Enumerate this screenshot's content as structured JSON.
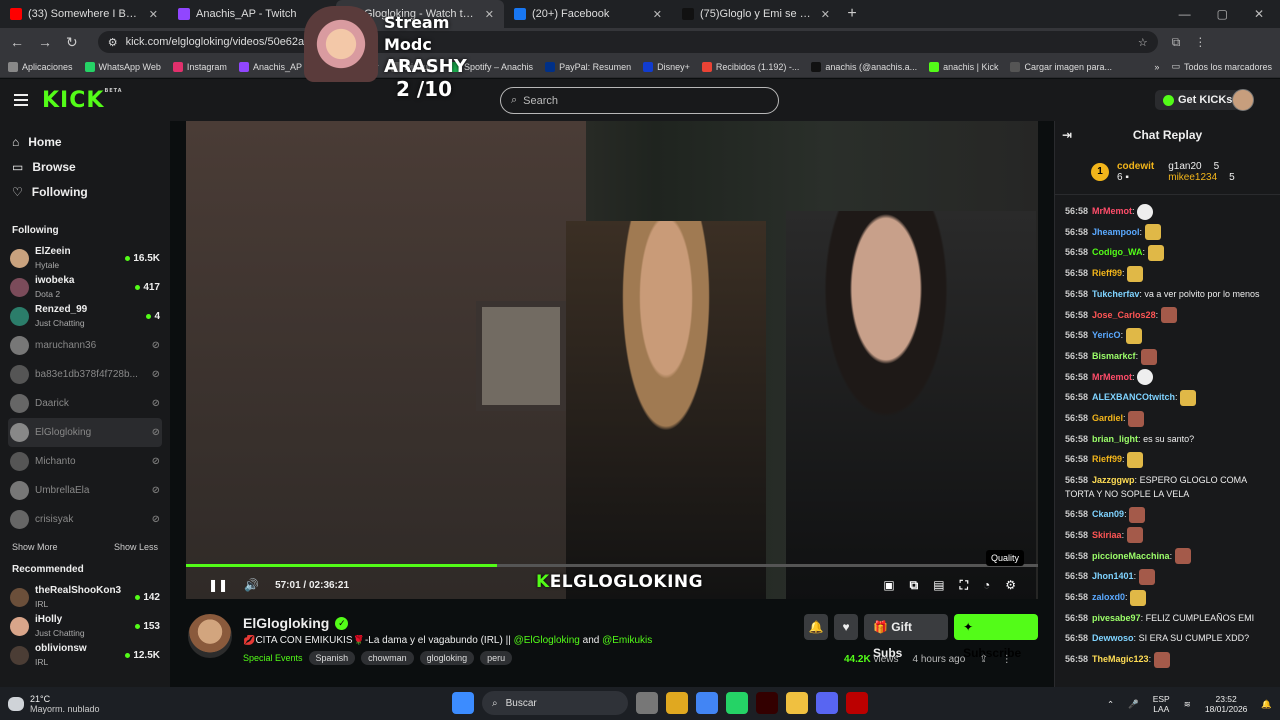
{
  "browser": {
    "tabs": [
      {
        "title": "(33) Somewhere I Belong (C",
        "color": "#ff0000"
      },
      {
        "title": "Anachis_AP - Twitch",
        "color": "#9146ff"
      },
      {
        "title": "Glogloking - Watch the V",
        "color": "#53fc18"
      },
      {
        "title": "(20+) Facebook",
        "color": "#1877f2"
      },
      {
        "title": "(75)Gloglo y Emi se muestran p",
        "color": "#111111"
      }
    ],
    "new_tab": "+",
    "url": "kick.com/elglogloking/videos/50e62a7d-e9e8-41",
    "bookmarks": [
      {
        "label": "Aplicaciones",
        "color": "#888888"
      },
      {
        "label": "WhatsApp Web",
        "color": "#25d366"
      },
      {
        "label": "Instagram",
        "color": "#e1306c"
      },
      {
        "label": "Anachis_AP",
        "color": "#9146ff"
      },
      {
        "label": "ube",
        "color": "#ff0000"
      },
      {
        "label": "Cr",
        "color": "#777777"
      },
      {
        "label": "Disfrut...",
        "color": "#777777"
      },
      {
        "label": "Spotify – Anachis",
        "color": "#1db954"
      },
      {
        "label": "PayPal: Resumen",
        "color": "#003087"
      },
      {
        "label": "Disney+",
        "color": "#113ccf"
      },
      {
        "label": "Recibidos (1.192) -...",
        "color": "#ea4335"
      },
      {
        "label": "anachis (@anachis.a...",
        "color": "#111111"
      },
      {
        "label": "anachis | Kick",
        "color": "#53fc18"
      },
      {
        "label": "Cargar imagen para...",
        "color": "#555555"
      }
    ],
    "bookmarks_more": "»",
    "bookmarks_folder": "Todos los marcadores"
  },
  "overlay": {
    "line1": "Stream Modc",
    "line2": "ARASHY",
    "line3": "2 /10"
  },
  "kick": {
    "logo": "KICK",
    "logo_beta": "BETA",
    "search_placeholder": "Search",
    "get_kicks": "Get KICKs",
    "nav": {
      "home": "Home",
      "browse": "Browse",
      "following": "Following"
    },
    "following_title": "Following",
    "following": [
      {
        "name": "ElZeein",
        "cat": "Hytale",
        "viewers": "16.5K",
        "live": true,
        "color": "#c9a27e"
      },
      {
        "name": "iwobeka",
        "cat": "Dota 2",
        "viewers": "417",
        "live": true,
        "color": "#7b4b5a"
      },
      {
        "name": "Renzed_99",
        "cat": "Just Chatting",
        "viewers": "4",
        "live": true,
        "color": "#2b7d6a"
      },
      {
        "name": "maruchann36",
        "cat": "",
        "viewers": "",
        "live": false,
        "color": "#777777"
      },
      {
        "name": "ba83e1db378f4f728b...",
        "cat": "",
        "viewers": "",
        "live": false,
        "color": "#555555"
      },
      {
        "name": "Daarick",
        "cat": "",
        "viewers": "",
        "live": false,
        "color": "#666666"
      },
      {
        "name": "ElGlogloking",
        "cat": "",
        "viewers": "",
        "live": false,
        "color": "#888888"
      },
      {
        "name": "Michanto",
        "cat": "",
        "viewers": "",
        "live": false,
        "color": "#555555"
      },
      {
        "name": "UmbrellaEla",
        "cat": "",
        "viewers": "",
        "live": false,
        "color": "#777777"
      },
      {
        "name": "crisisyak",
        "cat": "",
        "viewers": "",
        "live": false,
        "color": "#666666"
      }
    ],
    "show_more": "Show More",
    "show_less": "Show Less",
    "recommended_title": "Recommended",
    "recommended": [
      {
        "name": "theRealShooKon3",
        "cat": "IRL",
        "viewers": "142",
        "color": "#6b4f3a"
      },
      {
        "name": "iHolly",
        "cat": "Just Chatting",
        "viewers": "153",
        "color": "#d9a58a"
      },
      {
        "name": "oblivionsw",
        "cat": "IRL",
        "viewers": "12.5K",
        "color": "#4b3d35"
      }
    ],
    "player": {
      "time_current": "57:01",
      "time_total": "02:36:21",
      "time_sep": "/",
      "progress": 0.365,
      "watermark_k": "K",
      "watermark": "ELGLOGLOKING",
      "tooltip": "Quality"
    },
    "channel": {
      "name": "ElGlogloking",
      "title_prefix": "💋CITA CON EMIKUKIS🌹-La dama y el vagabundo (IRL) || ",
      "mention1": "@ElGlogloking",
      "and": " and ",
      "mention2": "@Emikukis",
      "category": "Special Events",
      "tags": [
        "Spanish",
        "chowman",
        "glogloking",
        "peru"
      ],
      "gift_subs": "Gift Subs",
      "subscribe": "Subscribe",
      "views": "44.2K",
      "views_label": "views",
      "ago": "4 hours ago"
    },
    "chat": {
      "title": "Chat Replay",
      "leader1": {
        "rank": "1",
        "name": "codewit",
        "count": "6"
      },
      "leader2": {
        "name": "g1an20",
        "count": "5"
      },
      "leader3": {
        "name": "mikee1234",
        "count": "5"
      },
      "messages": [
        {
          "time": "56:58",
          "user": "MrMemot",
          "color": "#ff4d6a",
          "text": "",
          "emote": "w"
        },
        {
          "time": "56:58",
          "user": "Jheampool",
          "color": "#5aa9ff",
          "text": "",
          "emote": "y"
        },
        {
          "time": "56:58",
          "user": "Codigo_WA",
          "color": "#53fc18",
          "text": "",
          "emote": "y"
        },
        {
          "time": "56:58",
          "user": "Rieff99",
          "color": "#f2b51b",
          "text": "",
          "emote": "y"
        },
        {
          "time": "56:58",
          "user": "Tukcherfav",
          "color": "#7fd3ff",
          "text": "va a ver polvito por lo menos",
          "emote": ""
        },
        {
          "time": "56:58",
          "user": "Jose_Carlos28",
          "color": "#ff5555",
          "text": "",
          "emote": "r"
        },
        {
          "time": "56:58",
          "user": "YericO",
          "color": "#5aa9ff",
          "text": "",
          "emote": "y"
        },
        {
          "time": "56:58",
          "user": "Bismarkcf",
          "color": "#9cff6a",
          "text": "",
          "emote": "r"
        },
        {
          "time": "56:58",
          "user": "MrMemot",
          "color": "#ff4d6a",
          "text": "",
          "emote": "w"
        },
        {
          "time": "56:58",
          "user": "ALEXBANCOtwitch",
          "color": "#7fd3ff",
          "text": "",
          "emote": "y"
        },
        {
          "time": "56:58",
          "user": "Gardiel",
          "color": "#f2b51b",
          "text": "",
          "emote": "r"
        },
        {
          "time": "56:58",
          "user": "brian_light",
          "color": "#9cff6a",
          "text": "es su santo?",
          "emote": ""
        },
        {
          "time": "56:58",
          "user": "Rieff99",
          "color": "#f2b51b",
          "text": "",
          "emote": "y"
        },
        {
          "time": "56:58",
          "user": "Jazzggwp",
          "color": "#ffdd55",
          "text": "ESPERO GLOGLO COMA TORTA Y NO SOPLE LA VELA",
          "emote": ""
        },
        {
          "time": "56:58",
          "user": "Ckan09",
          "color": "#7fd3ff",
          "text": "",
          "emote": "r"
        },
        {
          "time": "56:58",
          "user": "Skiriaa",
          "color": "#ff5555",
          "text": "",
          "emote": "r"
        },
        {
          "time": "56:58",
          "user": "piccioneMacchina",
          "color": "#9cff6a",
          "text": "",
          "emote": "r"
        },
        {
          "time": "56:58",
          "user": "Jhon1401",
          "color": "#7fd3ff",
          "text": "",
          "emote": "r"
        },
        {
          "time": "56:58",
          "user": "zaloxd0",
          "color": "#5aa9ff",
          "text": "",
          "emote": "y"
        },
        {
          "time": "56:58",
          "user": "pivesabe97",
          "color": "#9cff6a",
          "text": "FELIZ CUMPLEAÑOS EMI",
          "emote": ""
        },
        {
          "time": "56:58",
          "user": "Dewwoso",
          "color": "#7fd3ff",
          "text": "SI ERA SU CUMPLE XDD?",
          "emote": ""
        },
        {
          "time": "56:58",
          "user": "TheMagic123",
          "color": "#ffdd55",
          "text": "",
          "emote": "r"
        }
      ]
    }
  },
  "taskbar": {
    "temp": "21°C",
    "weather": "Mayorm. nublado",
    "search": "Buscar",
    "lang1": "ESP",
    "lang2": "LAA",
    "time": "23:52",
    "date": "18/01/2026"
  }
}
